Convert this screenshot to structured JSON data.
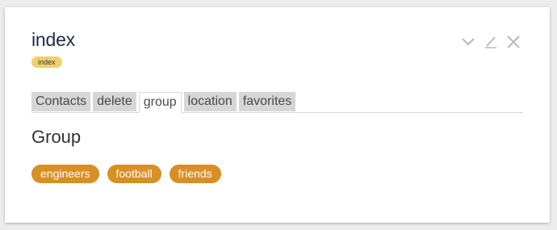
{
  "header": {
    "title": "index",
    "badge": "index"
  },
  "actions": {
    "collapse_icon": "chevron-down-icon",
    "edit_icon": "pencil-icon",
    "close_icon": "close-icon"
  },
  "tabs": [
    {
      "label": "Contacts",
      "active": false
    },
    {
      "label": "delete",
      "active": false
    },
    {
      "label": "group",
      "active": true
    },
    {
      "label": "location",
      "active": false
    },
    {
      "label": "favorites",
      "active": false
    }
  ],
  "section": {
    "title": "Group",
    "tags": [
      "engineers",
      "football",
      "friends"
    ]
  },
  "colors": {
    "tag": "#d88f25",
    "badge": "#f0d06b",
    "title": "#1e2a48"
  }
}
